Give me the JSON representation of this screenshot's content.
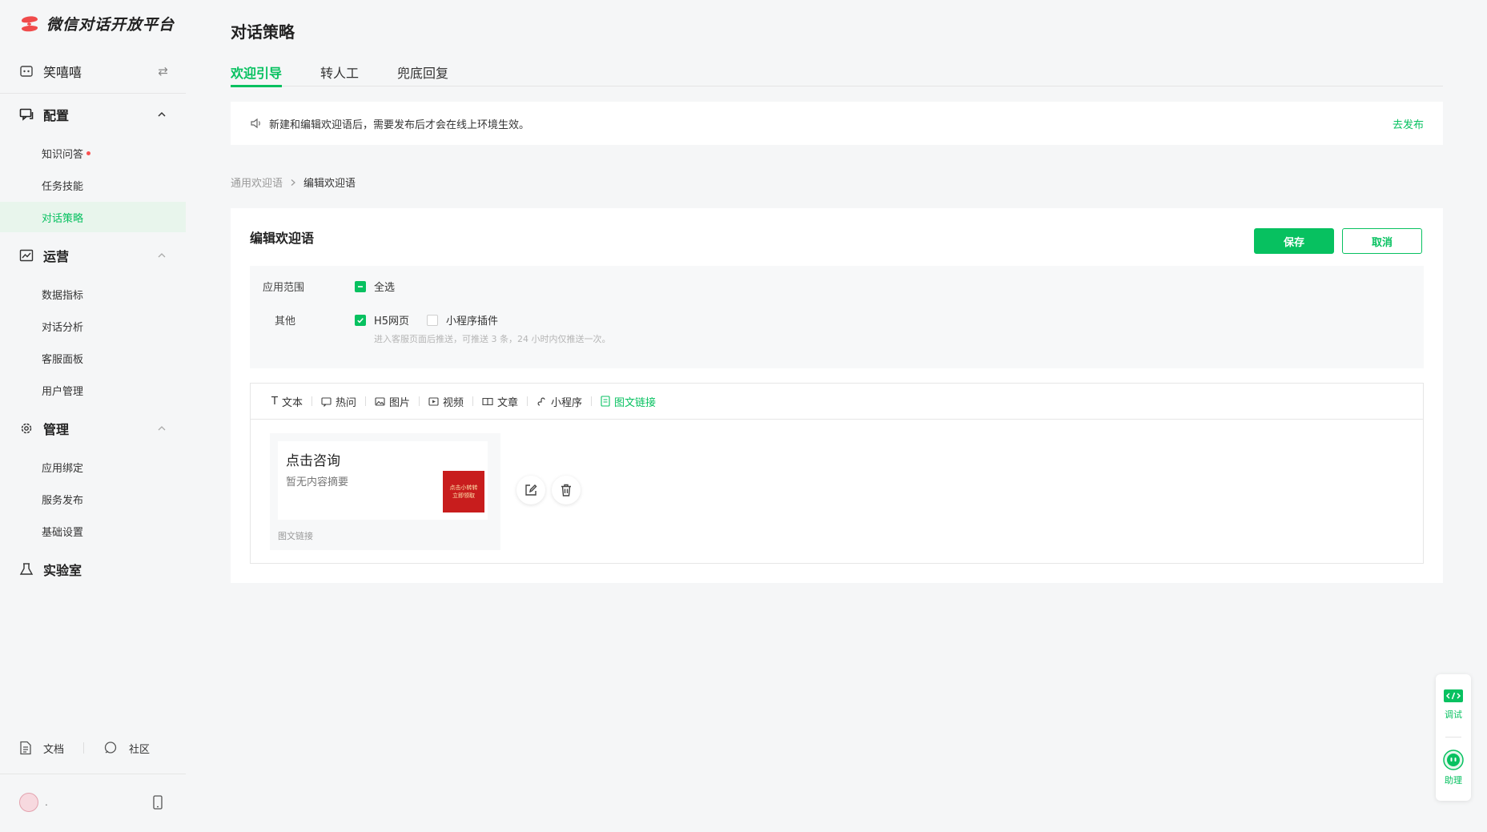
{
  "colors": {
    "accent": "#07c160",
    "danger": "#fa5151"
  },
  "logo": {
    "text": "微信对话开放平台",
    "icon": "wechat-dialog-logo-icon"
  },
  "account": {
    "name": "笑嘻嘻",
    "icon": "robot-face-icon",
    "swap_icon": "swap-arrows-icon"
  },
  "sidebar": {
    "groups": [
      {
        "label": "配置",
        "icon": "config-chat-icon",
        "items": [
          "知识问答",
          "任务技能",
          "对话策略"
        ]
      },
      {
        "label": "运营",
        "icon": "operation-chart-icon",
        "items": [
          "数据指标",
          "对话分析",
          "客服面板",
          "用户管理"
        ]
      },
      {
        "label": "管理",
        "icon": "gear-icon",
        "items": [
          "应用绑定",
          "服务发布",
          "基础设置"
        ]
      },
      {
        "label": "实验室",
        "icon": "lab-flask-icon",
        "items": []
      }
    ],
    "active_item": "对话策略",
    "docs_label": "文档",
    "community_label": "社区",
    "user_name": "."
  },
  "page": {
    "title": "对话策略",
    "tabs": [
      "欢迎引导",
      "转人工",
      "兜底回复"
    ],
    "active_tab": "欢迎引导",
    "notice": "新建和编辑欢迎语后，需要发布后才会在线上环境生效。",
    "notice_action": "去发布",
    "breadcrumb": [
      "通用欢迎语",
      "编辑欢迎语"
    ]
  },
  "editor_card": {
    "title": "编辑欢迎语",
    "save_label": "保存",
    "cancel_label": "取消",
    "scope_label": "应用范围",
    "select_all_label": "全选",
    "other_label": "其他",
    "h5_label": "H5网页",
    "h5_checked": true,
    "miniprogram_label": "小程序插件",
    "miniprogram_checked": false,
    "hint": "进入客服页面后推送，可推送 3 条，24 小时内仅推送一次。",
    "toolbar": [
      {
        "label": "文本",
        "icon": "text-T-icon"
      },
      {
        "label": "热问",
        "icon": "hot-question-icon"
      },
      {
        "label": "图片",
        "icon": "image-icon"
      },
      {
        "label": "视频",
        "icon": "video-icon"
      },
      {
        "label": "文章",
        "icon": "article-book-icon"
      },
      {
        "label": "小程序",
        "icon": "miniprogram-link-icon"
      },
      {
        "label": "图文链接",
        "icon": "image-text-link-icon"
      }
    ],
    "active_tool": "图文链接",
    "preview": {
      "title": "点击咨询",
      "desc": "暂无内容摘要",
      "thumb_text": "点击小转转 立即领取",
      "type_label": "图文链接"
    }
  },
  "float_panel": {
    "debug_label": "调试",
    "assistant_label": "助理"
  }
}
